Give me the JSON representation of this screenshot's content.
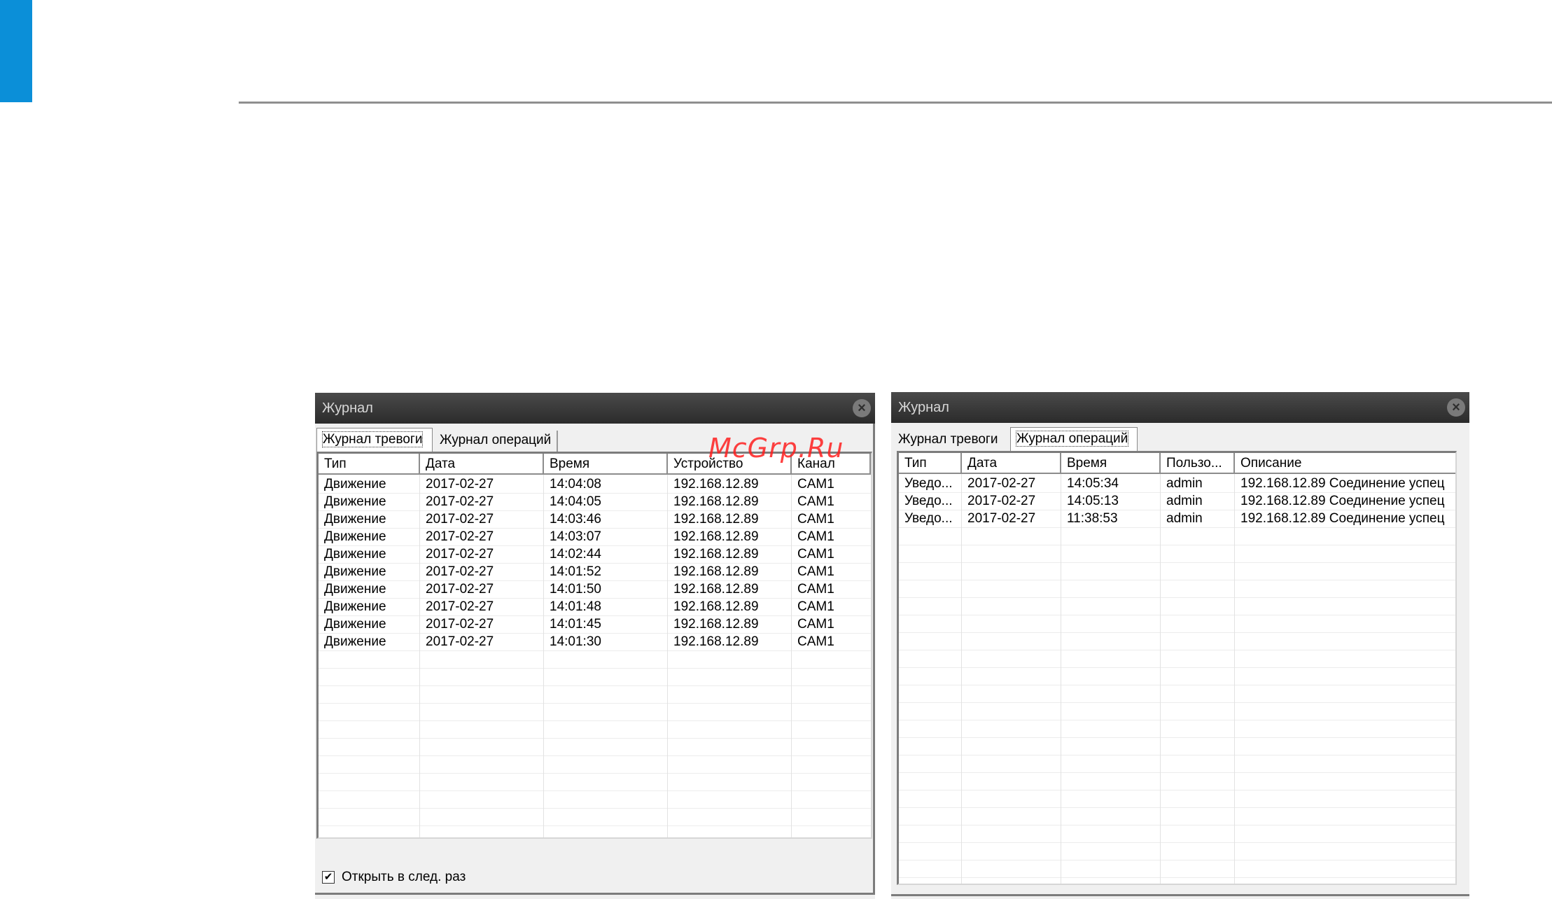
{
  "watermark": "McGrp.Ru",
  "left_window": {
    "title": "Журнал",
    "tabs": [
      "Журнал тревоги",
      "Журнал операций"
    ],
    "active_tab": "Журнал тревоги",
    "columns": [
      "Тип",
      "Дата",
      "Время",
      "Устройство",
      "Канал"
    ],
    "rows": [
      [
        "Движение",
        "2017-02-27",
        "14:04:08",
        "192.168.12.89",
        "CAM1"
      ],
      [
        "Движение",
        "2017-02-27",
        "14:04:05",
        "192.168.12.89",
        "CAM1"
      ],
      [
        "Движение",
        "2017-02-27",
        "14:03:46",
        "192.168.12.89",
        "CAM1"
      ],
      [
        "Движение",
        "2017-02-27",
        "14:03:07",
        "192.168.12.89",
        "CAM1"
      ],
      [
        "Движение",
        "2017-02-27",
        "14:02:44",
        "192.168.12.89",
        "CAM1"
      ],
      [
        "Движение",
        "2017-02-27",
        "14:01:52",
        "192.168.12.89",
        "CAM1"
      ],
      [
        "Движение",
        "2017-02-27",
        "14:01:50",
        "192.168.12.89",
        "CAM1"
      ],
      [
        "Движение",
        "2017-02-27",
        "14:01:48",
        "192.168.12.89",
        "CAM1"
      ],
      [
        "Движение",
        "2017-02-27",
        "14:01:45",
        "192.168.12.89",
        "CAM1"
      ],
      [
        "Движение",
        "2017-02-27",
        "14:01:30",
        "192.168.12.89",
        "CAM1"
      ]
    ],
    "open_next_time_label": "Открыть в след. раз",
    "open_next_time_checked": true
  },
  "right_window": {
    "title": "Журнал",
    "tabs": [
      "Журнал тревоги",
      "Журнал операций"
    ],
    "active_tab": "Журнал операций",
    "columns": [
      "Тип",
      "Дата",
      "Время",
      "Пользо...",
      "Описание"
    ],
    "rows": [
      [
        "Уведо...",
        "2017-02-27",
        "14:05:34",
        "admin",
        "192.168.12.89 Соединение успец"
      ],
      [
        "Уведо...",
        "2017-02-27",
        "14:05:13",
        "admin",
        "192.168.12.89 Соединение успец"
      ],
      [
        "Уведо...",
        "2017-02-27",
        "11:38:53",
        "admin",
        "192.168.12.89 Соединение успец"
      ]
    ]
  },
  "colors": {
    "accent_blue": "#0b8fd8",
    "title_bar": "#333333",
    "watermark_red": "#ff1f1f"
  }
}
